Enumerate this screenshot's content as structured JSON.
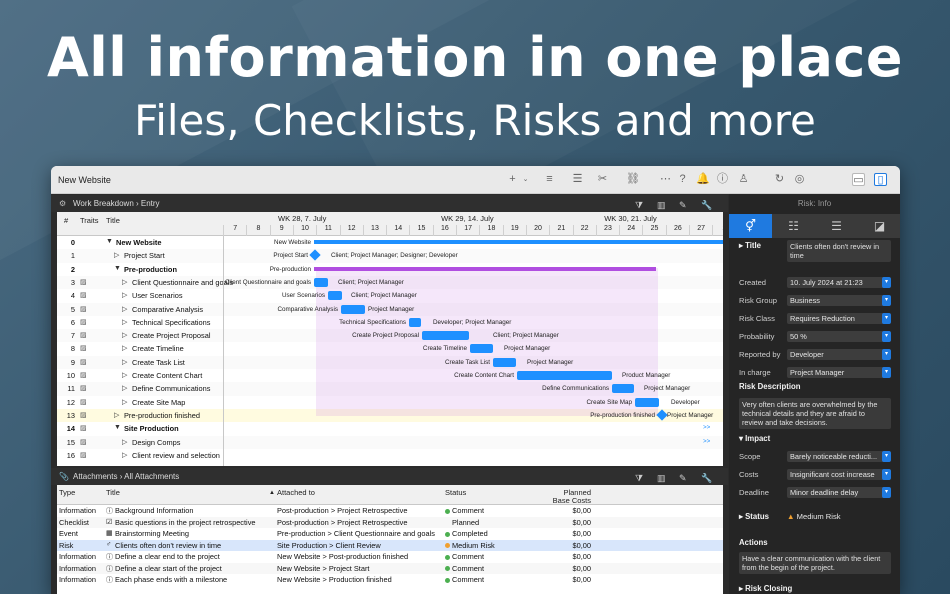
{
  "headline": {
    "title": "All information in one place",
    "subtitle": "Files, Checklists, Risks and more"
  },
  "window": {
    "title": "New Website"
  },
  "gantt": {
    "breadcrumb": [
      "Work Breakdown",
      "Entry"
    ],
    "columns": {
      "num": "#",
      "traits": "Traits",
      "title": "Title"
    },
    "weeks": [
      "WK 28, 7. July",
      "WK 29, 14. July",
      "WK 30, 21. July",
      "W"
    ],
    "days": [
      "7",
      "8",
      "9",
      "10",
      "11",
      "12",
      "13",
      "14",
      "15",
      "16",
      "17",
      "18",
      "19",
      "20",
      "21",
      "22",
      "23",
      "24",
      "25",
      "26",
      "27",
      "2"
    ],
    "rows": [
      {
        "num": "0",
        "title": "New Website",
        "bold": true,
        "indent": 0,
        "expand": "▼"
      },
      {
        "num": "1",
        "title": "Project Start",
        "bold": false,
        "indent": 1,
        "expand": "▷"
      },
      {
        "num": "2",
        "title": "Pre-production",
        "bold": true,
        "indent": 1,
        "expand": "▼"
      },
      {
        "num": "3",
        "title": "Client Questionnaire and goals",
        "bold": false,
        "indent": 2,
        "expand": "▷"
      },
      {
        "num": "4",
        "title": "User Scenarios",
        "bold": false,
        "indent": 2,
        "expand": "▷"
      },
      {
        "num": "5",
        "title": "Comparative Analysis",
        "bold": false,
        "indent": 2,
        "expand": "▷"
      },
      {
        "num": "6",
        "title": "Technical Specifications",
        "bold": false,
        "indent": 2,
        "expand": "▷"
      },
      {
        "num": "7",
        "title": "Create Project Proposal",
        "bold": false,
        "indent": 2,
        "expand": "▷"
      },
      {
        "num": "8",
        "title": "Create Timeline",
        "bold": false,
        "indent": 2,
        "expand": "▷"
      },
      {
        "num": "9",
        "title": "Create Task List",
        "bold": false,
        "indent": 2,
        "expand": "▷"
      },
      {
        "num": "10",
        "title": "Create Content Chart",
        "bold": false,
        "indent": 2,
        "expand": "▷"
      },
      {
        "num": "11",
        "title": "Define Communications",
        "bold": false,
        "indent": 2,
        "expand": "▷"
      },
      {
        "num": "12",
        "title": "Create Site Map",
        "bold": false,
        "indent": 2,
        "expand": "▷"
      },
      {
        "num": "13",
        "title": "Pre-production finished",
        "bold": false,
        "indent": 1,
        "expand": "▷"
      },
      {
        "num": "14",
        "title": "Site Production",
        "bold": true,
        "indent": 1,
        "expand": "▼"
      },
      {
        "num": "15",
        "title": "Design Comps",
        "bold": false,
        "indent": 2,
        "expand": "▷"
      },
      {
        "num": "16",
        "title": "Client review and selection",
        "bold": false,
        "indent": 2,
        "expand": "▷"
      }
    ],
    "chart_labels": [
      {
        "text": "New Website",
        "side": "left"
      },
      {
        "text": "Project Start",
        "side": "left",
        "res": "Client; Project Manager; Designer; Developer"
      },
      {
        "text": "Pre-production",
        "side": "left"
      },
      {
        "text": "Client Questionnaire and goals",
        "side": "left",
        "res": "Client; Project Manager"
      },
      {
        "text": "User Scenarios",
        "side": "left",
        "res": "Client; Project Manager"
      },
      {
        "text": "Comparative Analysis",
        "side": "left",
        "res": "Project Manager"
      },
      {
        "text": "Technical Specifications",
        "side": "left",
        "res": "Developer; Project Manager"
      },
      {
        "text": "Create Project Proposal",
        "side": "left",
        "res": "Client; Project Manager"
      },
      {
        "text": "Create Timeline",
        "side": "left",
        "res": "Project Manager"
      },
      {
        "text": "Create Task List",
        "side": "left",
        "res": "Project Manager"
      },
      {
        "text": "Create Content Chart",
        "side": "left",
        "res": "Product Manager"
      },
      {
        "text": "Define Communications",
        "side": "left",
        "res": "Project Manager"
      },
      {
        "text": "Create Site Map",
        "side": "left",
        "res": "Developer"
      },
      {
        "text": "Pre-production finished",
        "side": "left",
        "res": "Project Manager"
      }
    ]
  },
  "attachments": {
    "breadcrumb": [
      "Attachments",
      "All Attachments"
    ],
    "columns": {
      "type": "Type",
      "title": "Title",
      "attached": "Attached to",
      "status": "Status",
      "cost1": "Planned",
      "cost2": "Base Costs"
    },
    "rows": [
      {
        "type": "Information",
        "title": "Background Information",
        "attached": "Post-production > Project Retrospective",
        "status": "Comment",
        "cost": "$0,00",
        "color": "#4caf50"
      },
      {
        "type": "Checklist",
        "title": "Basic questions in the project retrospective",
        "attached": "Post-production > Project Retrospective",
        "status": "Planned",
        "cost": "$0,00",
        "color": ""
      },
      {
        "type": "Event",
        "title": "Brainstorming Meeting",
        "attached": "Pre-production > Client Questionnaire and goals",
        "status": "Completed",
        "cost": "$0,00",
        "color": "#4caf50"
      },
      {
        "type": "Risk",
        "title": "Clients often don't review in time",
        "attached": "Site Production > Client Review",
        "status": "Medium Risk",
        "cost": "$0,00",
        "color": "#f0a030"
      },
      {
        "type": "Information",
        "title": "Define a clear end to the project",
        "attached": "New Website > Post-production finished",
        "status": "Comment",
        "cost": "$0,00",
        "color": "#4caf50"
      },
      {
        "type": "Information",
        "title": "Define a clear start of the project",
        "attached": "New Website > Project Start",
        "status": "Comment",
        "cost": "$0,00",
        "color": "#4caf50"
      },
      {
        "type": "Information",
        "title": "Each phase ends with a milestone",
        "attached": "New Website > Production finished",
        "status": "Comment",
        "cost": "$0,00",
        "color": "#4caf50"
      }
    ]
  },
  "inspector": {
    "header": "Risk: Info",
    "title_label": "Title",
    "title_value": "Clients often don't review in time",
    "fields": [
      {
        "label": "Created",
        "value": "10. July 2024 at 21:23"
      },
      {
        "label": "Risk Group",
        "value": "Business"
      },
      {
        "label": "Risk Class",
        "value": "Requires Reduction"
      },
      {
        "label": "Probability",
        "value": "50 %"
      },
      {
        "label": "Reported by",
        "value": "Developer"
      },
      {
        "label": "In charge",
        "value": "Project Manager"
      }
    ],
    "description_label": "Risk Description",
    "description": "Very often clients are overwhelmed by the technical details and they are afraid to review and take decisions.",
    "impact_label": "Impact",
    "impact": [
      {
        "label": "Scope",
        "value": "Barely noticeable reducti..."
      },
      {
        "label": "Costs",
        "value": "Insignificant cost increase"
      },
      {
        "label": "Deadline",
        "value": "Minor deadline delay"
      }
    ],
    "status_label": "Status",
    "status_value": "Medium Risk",
    "actions_label": "Actions",
    "actions": "Have a clear communication with the client from the begin of the project.",
    "closing_label": "Risk Closing"
  }
}
